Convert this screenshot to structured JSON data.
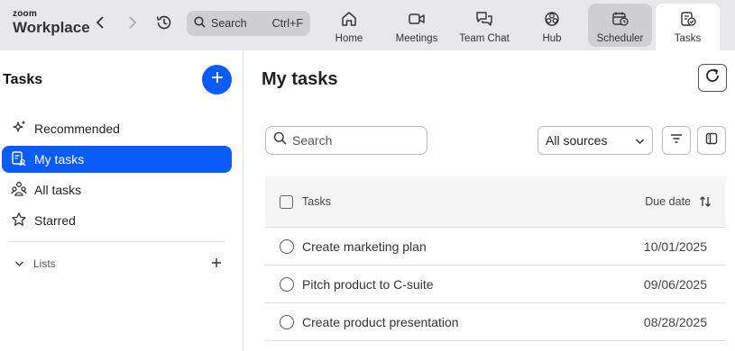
{
  "app": {
    "logo_top": "zoom",
    "logo_bottom": "Workplace"
  },
  "topbar": {
    "search_label": "Search",
    "search_shortcut": "Ctrl+F",
    "tabs": [
      {
        "label": "Home",
        "icon": "home-icon"
      },
      {
        "label": "Meetings",
        "icon": "video-icon"
      },
      {
        "label": "Team Chat",
        "icon": "chat-icon"
      },
      {
        "label": "Hub",
        "icon": "hub-icon"
      },
      {
        "label": "Scheduler",
        "icon": "calendar-clock-icon"
      },
      {
        "label": "Tasks",
        "icon": "tasks-icon"
      }
    ],
    "active_tab": "Tasks"
  },
  "sidebar": {
    "title": "Tasks",
    "items": [
      {
        "label": "Recommended",
        "icon": "sparkle-icon"
      },
      {
        "label": "My tasks",
        "icon": "my-tasks-icon",
        "selected": true
      },
      {
        "label": "All tasks",
        "icon": "people-icon"
      },
      {
        "label": "Starred",
        "icon": "star-icon"
      }
    ],
    "lists_label": "Lists"
  },
  "main": {
    "title": "My tasks",
    "search_placeholder": "Search",
    "source_value": "All sources",
    "table": {
      "col_tasks": "Tasks",
      "col_due": "Due date",
      "rows": [
        {
          "name": "Create marketing plan",
          "due": "10/01/2025"
        },
        {
          "name": "Pitch product to C-suite",
          "due": "09/06/2025"
        },
        {
          "name": "Create product presentation",
          "due": "08/28/2025"
        }
      ]
    }
  },
  "colors": {
    "accent": "#0b5cff",
    "topbar_bg": "#e8e8ea"
  }
}
